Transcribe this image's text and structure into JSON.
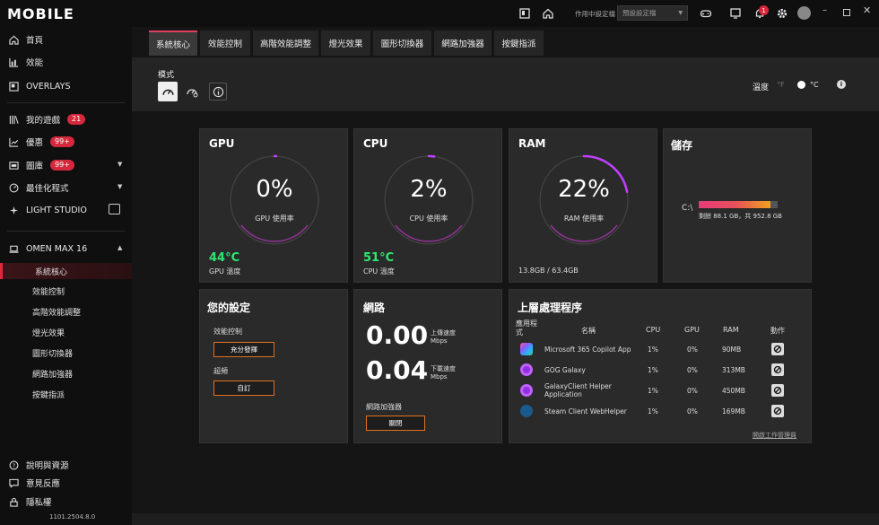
{
  "app": {
    "logo": "MOBILE",
    "version": "1101.2504.8.0"
  },
  "sidebar": {
    "items": [
      {
        "label": "首頁"
      },
      {
        "label": "效能"
      },
      {
        "label": "OVERLAYS"
      },
      {
        "label": "我的遊戲",
        "badge": "21"
      },
      {
        "label": "優惠",
        "badge": "99+"
      },
      {
        "label": "圖庫",
        "badge": "99+"
      },
      {
        "label": "最佳化程式"
      },
      {
        "label": "LIGHT STUDIO"
      }
    ],
    "device": "OMEN MAX 16",
    "device_items": [
      "系統核心",
      "效能控制",
      "高階效能調整",
      "燈光效果",
      "圖形切換器",
      "網路加強器",
      "按鍵指派"
    ],
    "bottom": [
      "說明與資源",
      "意見反應",
      "隱私權"
    ]
  },
  "topbar": {
    "profile_label": "作用中設定檔",
    "profile_value": "預設設定檔",
    "notification_count": "1"
  },
  "tabs": [
    "系統核心",
    "效能控制",
    "高階效能調整",
    "燈光效果",
    "圖形切換器",
    "網路加強器",
    "按鍵指派"
  ],
  "mode": {
    "label": "模式"
  },
  "temperature": {
    "label": "溫度",
    "f": "°F",
    "c": "°C"
  },
  "gpu": {
    "title": "GPU",
    "value": "0%",
    "sub": "GPU 使用率",
    "usage": 0,
    "temp": "44°C",
    "temp_label": "GPU 溫度"
  },
  "cpu": {
    "title": "CPU",
    "value": "2%",
    "sub": "CPU 使用率",
    "usage": 2,
    "temp": "51°C",
    "temp_label": "CPU 溫度"
  },
  "ram": {
    "title": "RAM",
    "value": "22%",
    "sub": "RAM 使用率",
    "usage": 22,
    "detail": "13.8GB / 63.4GB"
  },
  "storage": {
    "title": "儲存",
    "drive": "C:\\",
    "used_fraction": 0.91,
    "detail": "剩餘 88.1 GB，共 952.8 GB"
  },
  "settings": {
    "title": "您的設定",
    "perf_label": "效能控制",
    "perf_value": "充分發揮",
    "oc_label": "超頻",
    "oc_value": "自訂"
  },
  "network": {
    "title": "網路",
    "up": "0.00",
    "up_label": "上傳速度",
    "up_unit": "Mbps",
    "down": "0.04",
    "down_label": "下載速度",
    "down_unit": "Mbps",
    "booster_label": "網路加強器",
    "booster_value": "關閉"
  },
  "processes": {
    "title": "上層處理程序",
    "headers": [
      "應用程式",
      "名稱",
      "CPU",
      "GPU",
      "RAM",
      "動作"
    ],
    "rows": [
      {
        "name": "Microsoft 365 Copilot App",
        "cpu": "1%",
        "gpu": "0%",
        "ram": "90MB"
      },
      {
        "name": "GOG Galaxy",
        "cpu": "1%",
        "gpu": "0%",
        "ram": "313MB"
      },
      {
        "name": "GalaxyClient Helper Application",
        "cpu": "1%",
        "gpu": "0%",
        "ram": "450MB"
      },
      {
        "name": "Steam Client WebHelper",
        "cpu": "1%",
        "gpu": "0%",
        "ram": "169MB"
      }
    ],
    "link": "開啟工作管理員"
  }
}
